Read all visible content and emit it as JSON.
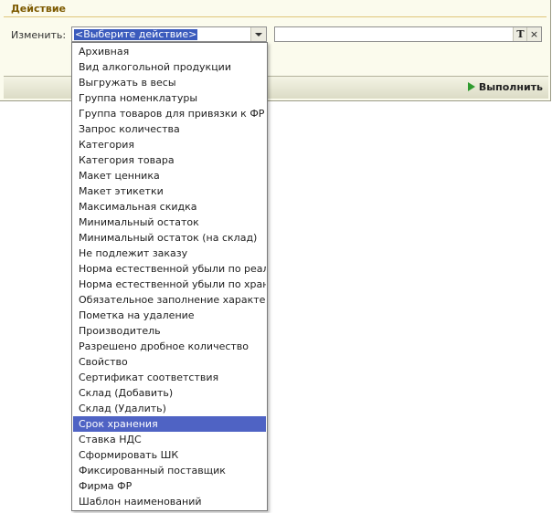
{
  "section": {
    "title": "Действие"
  },
  "change": {
    "label": "Изменить:",
    "selected_value": "<Выберите действие>"
  },
  "value_field": {
    "text": "",
    "type_button": "T",
    "clear_button": "×"
  },
  "footer": {
    "run_label": "Выполнить"
  },
  "dropdown": {
    "items": [
      "Архивная",
      "Вид алкогольной продукции",
      "Выгружать в весы",
      "Группа номенклатуры",
      "Группа товаров для привязки к ФР",
      "Запрос количества",
      "Категория",
      "Категория товара",
      "Макет ценника",
      "Макет этикетки",
      "Максимальная скидка",
      "Минимальный остаток",
      "Минимальный остаток (на склад)",
      "Не подлежит заказу",
      "Норма естественной убыли по реализ...",
      "Норма естественной убыли по хранен...",
      "Обязательное заполнение характерис...",
      "Пометка на удаление",
      "Производитель",
      "Разрешено дробное количество",
      "Свойство",
      "Сертификат соответствия",
      "Склад (Добавить)",
      "Склад (Удалить)",
      "Срок хранения",
      "Ставка НДС",
      "Сформировать ШК",
      "Фиксированный поставщик",
      "Фирма ФР",
      "Шаблон наименований"
    ],
    "highlighted": "Срок хранения"
  },
  "colors": {
    "accent": "#4f63c4",
    "title": "#7d5a00",
    "run_icon": "#2f9b2f"
  }
}
